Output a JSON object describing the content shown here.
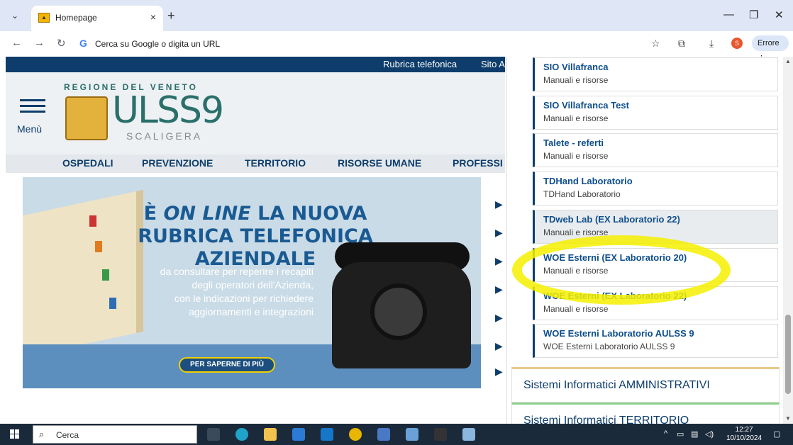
{
  "browser": {
    "tab_title": "Homepage",
    "tab_close": "×",
    "new_tab": "+",
    "address_placeholder": "Cerca su Google o digita un URL",
    "error_label": "Errore",
    "profile_initial": "S"
  },
  "site": {
    "topbar_links": [
      "Rubrica telefonica",
      "Sito A"
    ],
    "regione": "REGIONE DEL VENETO",
    "logo_main": "ULSS9",
    "logo_sub": "SCALIGERA",
    "menu_label": "Menù",
    "nav": [
      "OSPEDALI",
      "PREVENZIONE",
      "TERRITORIO",
      "RISORSE UMANE",
      "PROFESSI"
    ]
  },
  "banner": {
    "headline_prefix": "È ",
    "headline_em": "ON LINE",
    "headline_rest": " LA NUOVA RUBRICA TELEFONICA AZIENDALE",
    "lines": [
      "da consultare per reperire i recapiti",
      "degli operatori dell'Azienda,",
      "con le indicazioni per richiedere",
      "aggiornamenti e integrazioni"
    ],
    "cta": "PER SAPERNE DI PIÙ"
  },
  "panel": {
    "cards": [
      {
        "title": "SIO Villafranca",
        "subtitle": "Manuali e risorse"
      },
      {
        "title": "SIO Villafranca Test",
        "subtitle": "Manuali e risorse"
      },
      {
        "title": "Talete - referti",
        "subtitle": "Manuali e risorse"
      },
      {
        "title": "TDHand Laboratorio",
        "subtitle": "TDHand Laboratorio"
      },
      {
        "title": "TDweb Lab (EX Laboratorio 22)",
        "subtitle": "Manuali e risorse"
      },
      {
        "title": "WOE Esterni (EX Laboratorio 20)",
        "subtitle": "Manuali e risorse"
      },
      {
        "title": "WOE Esterni (EX Laboratorio 22)",
        "subtitle": "Manuali e risorse"
      },
      {
        "title": "WOE Esterni Laboratorio AULSS 9",
        "subtitle": "WOE Esterni Laboratorio AULSS 9"
      }
    ],
    "sections": [
      {
        "title": "Sistemi Informatici AMMINISTRATIVI",
        "color": "#e8c88a"
      },
      {
        "title": "Sistemi Informatici TERRITORIO",
        "color": "#8fd08f"
      }
    ]
  },
  "taskbar": {
    "search_placeholder": "Cerca",
    "time": "12:27",
    "date": "10/10/2024"
  },
  "colors": {
    "brand_blue": "#0e3d6b",
    "highlight_yellow": "#f4f000"
  }
}
